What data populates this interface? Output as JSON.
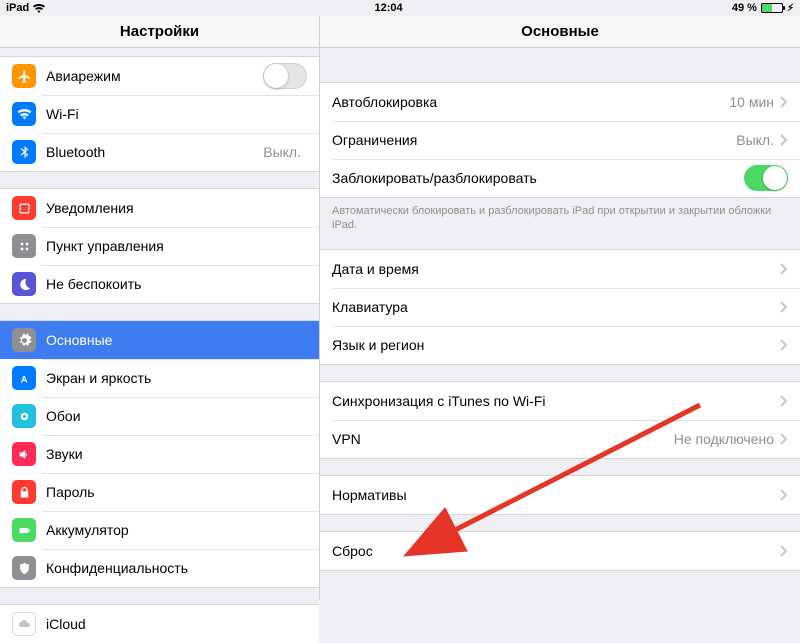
{
  "statusbar": {
    "device": "iPad",
    "time": "12:04",
    "battery_pct": "49 %"
  },
  "sidebar": {
    "title": "Настройки",
    "groupA": [
      {
        "label": "Авиарежим",
        "icon": "airplane",
        "bg": "#ff9500",
        "toggle": false
      },
      {
        "label": "Wi-Fi",
        "icon": "wifi",
        "bg": "#007aff",
        "value": ""
      },
      {
        "label": "Bluetooth",
        "icon": "bluetooth",
        "bg": "#007aff",
        "value": "Выкл."
      }
    ],
    "groupB": [
      {
        "label": "Уведомления",
        "icon": "notif",
        "bg": "#ff3b30"
      },
      {
        "label": "Пункт управления",
        "icon": "control",
        "bg": "#8e8e93"
      },
      {
        "label": "Не беспокоить",
        "icon": "dnd",
        "bg": "#5856d6"
      }
    ],
    "groupC": [
      {
        "label": "Основные",
        "icon": "gear",
        "bg": "#8e8e93",
        "selected": true
      },
      {
        "label": "Экран и яркость",
        "icon": "display",
        "bg": "#007aff"
      },
      {
        "label": "Обои",
        "icon": "wallpaper",
        "bg": "#22c1dc"
      },
      {
        "label": "Звуки",
        "icon": "sound",
        "bg": "#ff2d55"
      },
      {
        "label": "Пароль",
        "icon": "lock",
        "bg": "#ff3b30"
      },
      {
        "label": "Аккумулятор",
        "icon": "battery",
        "bg": "#4cd964"
      },
      {
        "label": "Конфиденциальность",
        "icon": "privacy",
        "bg": "#8e8e93"
      }
    ],
    "groupD": [
      {
        "label": "iCloud",
        "icon": "icloud",
        "bg": "#ffffff"
      }
    ]
  },
  "detail": {
    "title": "Основные",
    "g1": [
      {
        "label": "Автоблокировка",
        "value": "10 мин"
      },
      {
        "label": "Ограничения",
        "value": "Выкл."
      },
      {
        "label": "Заблокировать/разблокировать",
        "toggle": true
      }
    ],
    "g1_note": "Автоматически блокировать и разблокировать iPad при открытии и закрытии обложки iPad.",
    "g2": [
      {
        "label": "Дата и время"
      },
      {
        "label": "Клавиатура"
      },
      {
        "label": "Язык и регион"
      }
    ],
    "g3": [
      {
        "label": "Синхронизация с iTunes по Wi-Fi"
      },
      {
        "label": "VPN",
        "value": "Не подключено"
      }
    ],
    "g4": [
      {
        "label": "Нормативы"
      }
    ],
    "g5": [
      {
        "label": "Сброс"
      }
    ]
  }
}
